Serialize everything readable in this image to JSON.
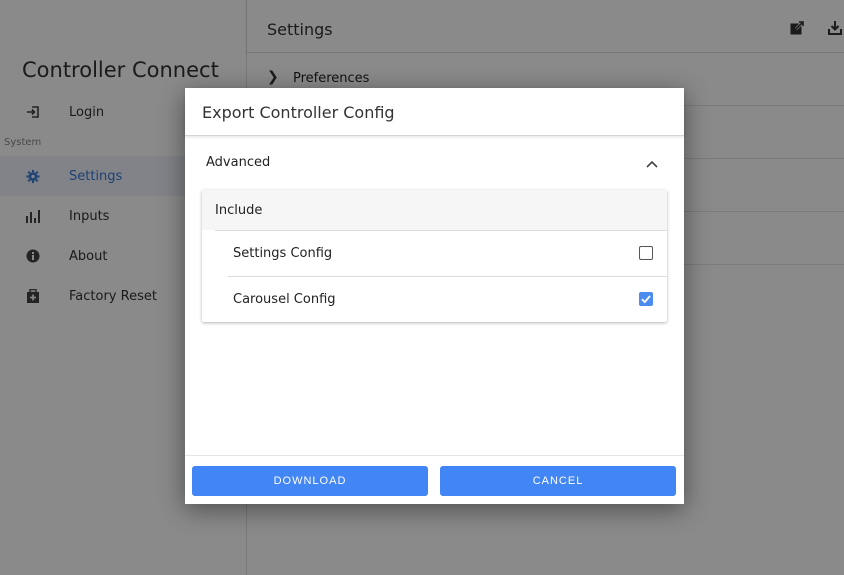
{
  "app": {
    "title": "Controller Connect"
  },
  "sidebar": {
    "login_label": "Login",
    "section_label": "System",
    "items": [
      {
        "label": "Settings",
        "icon": "gear-icon"
      },
      {
        "label": "Inputs",
        "icon": "bar-chart-icon"
      },
      {
        "label": "About",
        "icon": "info-icon"
      },
      {
        "label": "Factory Reset",
        "icon": "reset-icon"
      }
    ]
  },
  "topbar": {
    "title": "Settings"
  },
  "content": {
    "first_row_label": "Preferences"
  },
  "dialog": {
    "title": "Export Controller Config",
    "accordion_label": "Advanced",
    "include_label": "Include",
    "options": [
      {
        "label": "Settings Config",
        "checked": false
      },
      {
        "label": "Carousel Config",
        "checked": true
      }
    ],
    "download_label": "DOWNLOAD",
    "cancel_label": "CANCEL"
  },
  "colors": {
    "accent": "#4285f4",
    "active_text": "#3978d6"
  }
}
